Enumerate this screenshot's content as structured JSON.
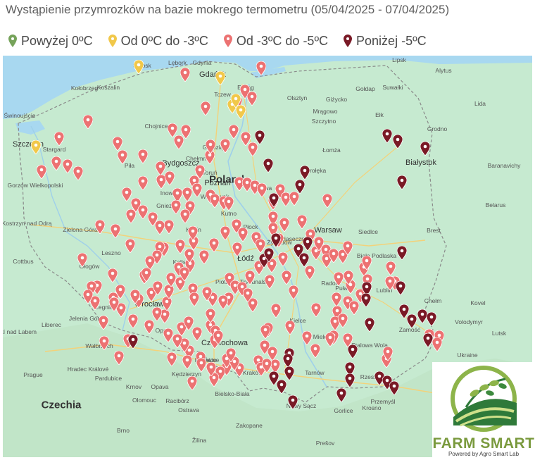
{
  "title": "Wystąpienie przymrozków na bazie mokrego termometru (05/04/2025 - 07/04/2025)",
  "legend": [
    {
      "label": "Powyżej 0ºC",
      "color": "#76a35a"
    },
    {
      "label": "Od 0ºC do -3ºC",
      "color": "#f1c84a"
    },
    {
      "label": "Od -3ºC do -5ºC",
      "color": "#ec7272"
    },
    {
      "label": "Poniżej -5ºC",
      "color": "#7a1a26"
    }
  ],
  "map": {
    "country_labels": [
      "Poland",
      "Czechia"
    ],
    "cities": [
      "Szczecin",
      "Gdańsk",
      "Gdynia",
      "Koszalin",
      "Słupsk",
      "Bydgoszcz",
      "Toruń",
      "Poznań",
      "Łódź",
      "Warsaw",
      "Białystok",
      "Lublin",
      "Kraków",
      "Wrocław",
      "Katowice",
      "Gliwice",
      "Częstochowa",
      "Kielce",
      "Radom",
      "Rzeszów",
      "Tarnów",
      "Płock",
      "Olsztyn",
      "Elbląg",
      "Siedlce",
      "Chełm",
      "Zamość",
      "Opole",
      "Legnica",
      "Zielona Góra",
      "Gorzów Wielkopolski",
      "Piła",
      "Gniezno",
      "Konin",
      "Kalisz",
      "Leszno",
      "Głogów",
      "Jelenia Góra",
      "Wałbrzych",
      "Nowy Sącz",
      "Bielsko-Biała",
      "Przemyśl",
      "Stalowa Wola",
      "Piotrków Trybunalski",
      "Ostrava",
      "Brno",
      "Prague",
      "Liberec",
      "Grodno",
      "Brest",
      "Lida",
      "Lutsk",
      "Kovel",
      "Volodymyr",
      "Baranavichy",
      "Alytus",
      "Prešov",
      "Tczew",
      "Grudziądz",
      "Ełk",
      "Suwałki",
      "Gołdap",
      "Giżycko",
      "Mrągowo",
      "Mława",
      "Ostrołęka",
      "Łomża",
      "Kutno",
      "Włocławek",
      "Inowrocław",
      "Chojnice",
      "Stargard",
      "Świnoujście",
      "Kołobrzeg",
      "Lębork",
      "Gorlice",
      "Zakopane",
      "Krosno",
      "Mielec",
      "Puławy",
      "Biała Podlaska",
      "Żyrardów",
      "Piaseczno",
      "Kędzierzyn",
      "Racibórz",
      "Cottbus",
      "Kostrzyn nad Odrą",
      "Hradec Králové",
      "Pardubice",
      "Olomouc",
      "Opava",
      "Krnov",
      "Žilina",
      "Ústí nad Labem",
      "Szczytno",
      "Chełmno",
      "Lipsk",
      "Ukraine",
      "Belarus"
    ],
    "pin_counts": {
      "above_0": 0,
      "zero_to_minus3": 6,
      "minus3_to_minus5": 180,
      "below_minus5": 38
    }
  },
  "logo": {
    "name": "FARM SMART",
    "tagline": "Powered by Agro Smart Lab"
  }
}
